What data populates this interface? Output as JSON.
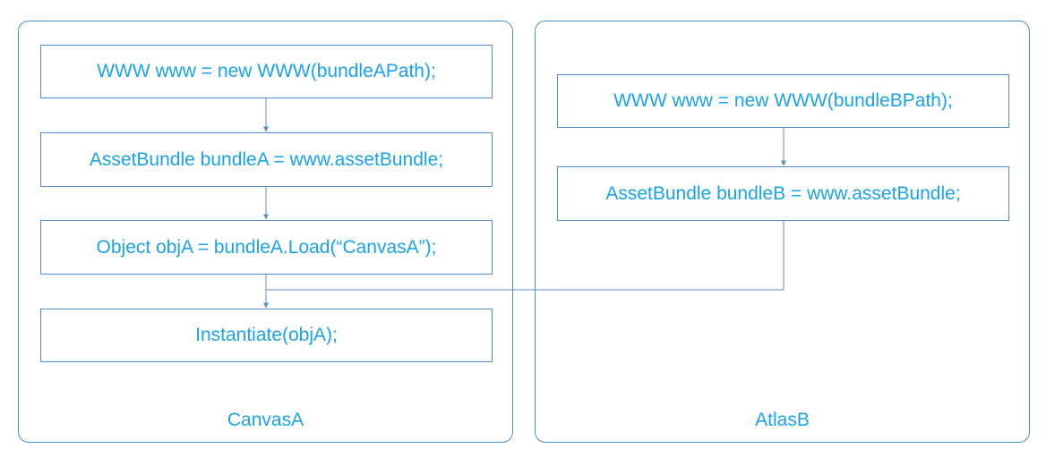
{
  "panels": {
    "canvas_a": {
      "label": "CanvasA",
      "steps": [
        "WWW www = new WWW(bundleAPath);",
        "AssetBundle bundleA = www.assetBundle;",
        "Object objA = bundleA.Load(“CanvasA”);",
        "Instantiate(objA);"
      ]
    },
    "atlas_b": {
      "label": "AtlasB",
      "steps": [
        "WWW www = new WWW(bundleBPath);",
        "AssetBundle bundleB = www.assetBundle;"
      ]
    }
  },
  "colors": {
    "text": "#1aa3e8",
    "border": "#5b8fc4",
    "connector": "#5b8fc4"
  }
}
